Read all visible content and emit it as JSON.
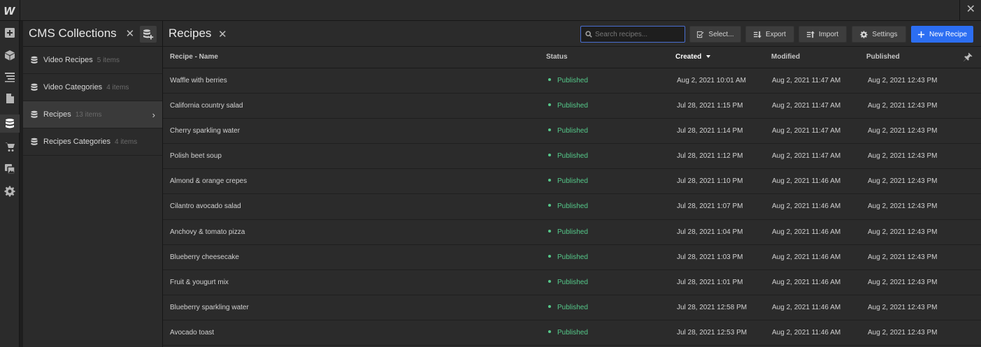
{
  "app": {
    "logo": "W",
    "close_label": "✕"
  },
  "rail": {
    "icons": [
      "add-icon",
      "box-icon",
      "navigator-icon",
      "page-icon",
      "database-icon",
      "cart-icon",
      "assets-icon",
      "gear-icon"
    ],
    "active": "database-icon"
  },
  "collections": {
    "title": "CMS Collections",
    "close_label": "✕",
    "items": [
      {
        "name": "Video Recipes",
        "count": "5 items"
      },
      {
        "name": "Video Categories",
        "count": "4 items"
      },
      {
        "name": "Recipes",
        "count": "13 items"
      },
      {
        "name": "Recipes Categories",
        "count": "4 items"
      }
    ],
    "active_item": "Recipes"
  },
  "main": {
    "title": "Recipes",
    "close_label": "✕",
    "search": {
      "placeholder": "Search recipes...",
      "value": ""
    },
    "buttons": {
      "select": "Select...",
      "export": "Export",
      "import": "Import",
      "settings": "Settings",
      "new": "New Recipe"
    },
    "columns": [
      "Recipe - Name",
      "Status",
      "Created",
      "Modified",
      "Published"
    ],
    "sorted_column": "Created",
    "rows": [
      {
        "name": "Waffle with berries",
        "status": "Published",
        "created": "Aug 2, 2021 10:01 AM",
        "modified": "Aug 2, 2021 11:47 AM",
        "published": "Aug 2, 2021 12:43 PM"
      },
      {
        "name": "California country salad",
        "status": "Published",
        "created": "Jul 28, 2021 1:15 PM",
        "modified": "Aug 2, 2021 11:47 AM",
        "published": "Aug 2, 2021 12:43 PM"
      },
      {
        "name": "Cherry sparkling water",
        "status": "Published",
        "created": "Jul 28, 2021 1:14 PM",
        "modified": "Aug 2, 2021 11:47 AM",
        "published": "Aug 2, 2021 12:43 PM"
      },
      {
        "name": "Polish beet soup",
        "status": "Published",
        "created": "Jul 28, 2021 1:12 PM",
        "modified": "Aug 2, 2021 11:47 AM",
        "published": "Aug 2, 2021 12:43 PM"
      },
      {
        "name": "Almond & orange crepes",
        "status": "Published",
        "created": "Jul 28, 2021 1:10 PM",
        "modified": "Aug 2, 2021 11:46 AM",
        "published": "Aug 2, 2021 12:43 PM"
      },
      {
        "name": "Cilantro avocado salad",
        "status": "Published",
        "created": "Jul 28, 2021 1:07 PM",
        "modified": "Aug 2, 2021 11:46 AM",
        "published": "Aug 2, 2021 12:43 PM"
      },
      {
        "name": "Anchovy & tomato pizza",
        "status": "Published",
        "created": "Jul 28, 2021 1:04 PM",
        "modified": "Aug 2, 2021 11:46 AM",
        "published": "Aug 2, 2021 12:43 PM"
      },
      {
        "name": "Blueberry cheesecake",
        "status": "Published",
        "created": "Jul 28, 2021 1:03 PM",
        "modified": "Aug 2, 2021 11:46 AM",
        "published": "Aug 2, 2021 12:43 PM"
      },
      {
        "name": "Fruit & yougurt mix",
        "status": "Published",
        "created": "Jul 28, 2021 1:01 PM",
        "modified": "Aug 2, 2021 11:46 AM",
        "published": "Aug 2, 2021 12:43 PM"
      },
      {
        "name": "Blueberry sparkling water",
        "status": "Published",
        "created": "Jul 28, 2021 12:58 PM",
        "modified": "Aug 2, 2021 11:46 AM",
        "published": "Aug 2, 2021 12:43 PM"
      },
      {
        "name": "Avocado toast",
        "status": "Published",
        "created": "Jul 28, 2021 12:53 PM",
        "modified": "Aug 2, 2021 11:46 AM",
        "published": "Aug 2, 2021 12:43 PM"
      }
    ]
  },
  "colors": {
    "accent": "#2c6ef2",
    "published": "#55c98a",
    "background": "#2b2b2b"
  }
}
